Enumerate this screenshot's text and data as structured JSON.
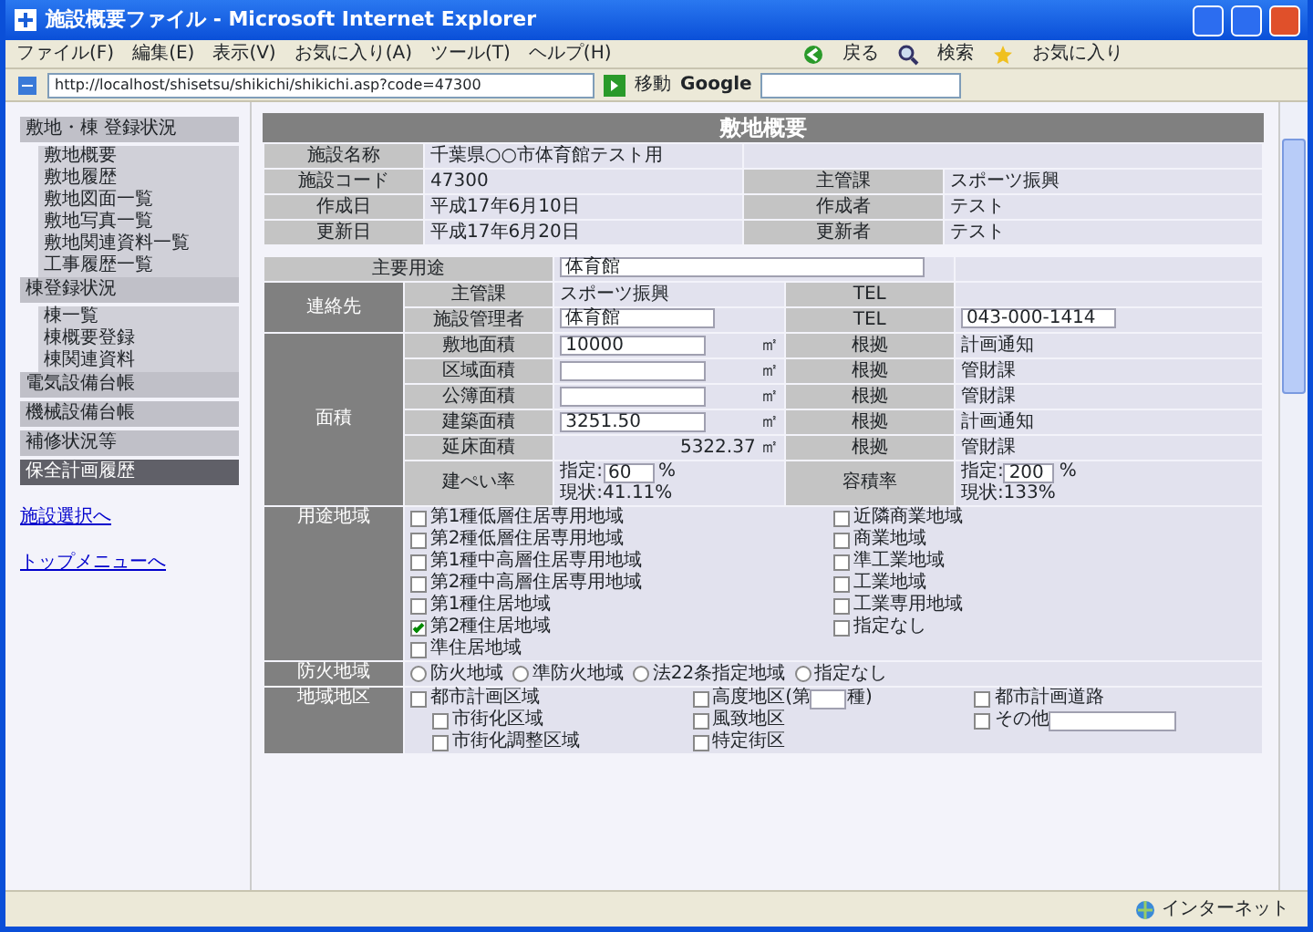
{
  "window": {
    "title": "施設概要ファイル - Microsoft Internet Explorer"
  },
  "menu": [
    "ファイル(F)",
    "編集(E)",
    "表示(V)",
    "お気に入り(A)",
    "ツール(T)",
    "ヘルプ(H)"
  ],
  "toolbar": {
    "back": "戻る",
    "search": "検索",
    "favorites": "お気に入り"
  },
  "address": {
    "url": "http://localhost/shisetsu/shikichi/shikichi.asp?code=47300"
  },
  "google": {
    "label": "Google",
    "go": "移動"
  },
  "sidebar": {
    "groups": [
      {
        "label": "敷地・棟 登録状況",
        "selected": false,
        "children": [
          {
            "label": "敷地概要",
            "selected": false
          },
          {
            "label": "敷地履歴",
            "selected": false
          },
          {
            "label": "敷地図面一覧",
            "selected": false
          },
          {
            "label": "敷地写真一覧",
            "selected": false
          },
          {
            "label": "敷地関連資料一覧",
            "selected": false
          },
          {
            "label": "工事履歴一覧",
            "selected": false
          }
        ]
      },
      {
        "label": "棟登録状況",
        "selected": false,
        "children": [
          {
            "label": "棟一覧",
            "selected": false
          },
          {
            "label": "棟概要登録",
            "selected": false
          },
          {
            "label": "棟関連資料",
            "selected": false
          }
        ]
      },
      {
        "label": "電気設備台帳",
        "selected": false
      },
      {
        "label": "機械設備台帳",
        "selected": false
      },
      {
        "label": "補修状況等",
        "selected": false
      },
      {
        "label": "保全計画履歴",
        "selected": true
      }
    ],
    "links": [
      "施設選択へ",
      "トップメニューへ"
    ]
  },
  "page": {
    "title": "敷地概要",
    "summary": [
      {
        "label": "施設名称",
        "value": "千葉県○○市体育館テスト用"
      },
      {
        "label": "施設コード",
        "value": "47300",
        "label2": "主管課",
        "value2": "スポーツ振興"
      },
      {
        "label": "作成日",
        "value": "平成17年6月10日",
        "label2": "作成者",
        "value2": "テスト"
      },
      {
        "label": "更新日",
        "value": "平成17年6月20日",
        "label2": "更新者",
        "value2": "テスト"
      }
    ],
    "main_use": {
      "label": "主要用途",
      "value": "体育館"
    },
    "sections": [
      {
        "heading": "連絡先",
        "rows": [
          [
            {
              "kind": "label",
              "text": "主管課"
            },
            {
              "kind": "value",
              "text": "スポーツ振興"
            },
            {
              "kind": "label",
              "text": "TEL"
            },
            {
              "kind": "value"
            }
          ],
          [
            {
              "kind": "label",
              "text": "施設管理者"
            },
            {
              "kind": "input",
              "value": "体育館"
            },
            {
              "kind": "label",
              "text": "TEL"
            },
            {
              "kind": "input",
              "value": "043-000-1414"
            }
          ]
        ]
      },
      {
        "heading": "面積",
        "rows": [
          [
            {
              "kind": "label",
              "text": "敷地面積"
            },
            {
              "kind": "area",
              "value": "10000",
              "unit": "㎡"
            },
            {
              "kind": "label",
              "text": "根拠"
            },
            {
              "kind": "value",
              "text": "計画通知"
            }
          ],
          [
            {
              "kind": "label",
              "text": "区域面積"
            },
            {
              "kind": "area",
              "unit": "㎡"
            },
            {
              "kind": "label",
              "text": "根拠"
            },
            {
              "kind": "value",
              "text": "管財課"
            }
          ],
          [
            {
              "kind": "label",
              "text": "公簿面積"
            },
            {
              "kind": "area",
              "unit": "㎡"
            },
            {
              "kind": "label",
              "text": "根拠"
            },
            {
              "kind": "value",
              "text": "管財課"
            }
          ],
          [
            {
              "kind": "label",
              "text": "建築面積"
            },
            {
              "kind": "area",
              "value": "3251.50",
              "unit": "㎡"
            },
            {
              "kind": "label",
              "text": "根拠"
            },
            {
              "kind": "value",
              "text": "計画通知"
            }
          ],
          [
            {
              "kind": "label",
              "text": "延床面積"
            },
            {
              "kind": "areatext",
              "value": "5322.37",
              "unit": "㎡"
            },
            {
              "kind": "label",
              "text": "根拠"
            },
            {
              "kind": "value",
              "text": "管財課"
            }
          ],
          [
            {
              "kind": "label",
              "text": "建ぺい率"
            },
            {
              "kind": "ratio",
              "prefix": "指定:",
              "value": "60",
              "suffix": "%",
              "current": "現状:41.11%"
            },
            {
              "kind": "label",
              "text": "容積率"
            },
            {
              "kind": "ratio",
              "prefix": "指定:",
              "value": "200",
              "suffix": "%",
              "current": "現状:133%"
            }
          ]
        ]
      }
    ],
    "zoning": {
      "heading": "用途地域",
      "columns": [
        [
          {
            "label": "第1種低層住居専用地域",
            "checked": false
          },
          {
            "label": "第2種低層住居専用地域",
            "checked": false
          },
          {
            "label": "第1種中高層住居専用地域",
            "checked": false
          },
          {
            "label": "第2種中高層住居専用地域",
            "checked": false
          },
          {
            "label": "第1種住居地域",
            "checked": false
          },
          {
            "label": "第2種住居地域",
            "checked": true
          },
          {
            "label": "準住居地域",
            "checked": false
          }
        ],
        [
          {
            "label": "近隣商業地域",
            "checked": false
          },
          {
            "label": "商業地域",
            "checked": false
          },
          {
            "label": "準工業地域",
            "checked": false
          },
          {
            "label": "工業地域",
            "checked": false
          },
          {
            "label": "工業専用地域",
            "checked": false
          },
          {
            "label": "指定なし",
            "checked": false
          }
        ]
      ]
    },
    "fire": {
      "heading": "防火地域",
      "options": [
        {
          "label": "防火地域",
          "selected": false
        },
        {
          "label": "準防火地域",
          "selected": false
        },
        {
          "label": "法22条指定地域",
          "selected": false
        },
        {
          "label": "指定なし",
          "selected": false
        }
      ]
    },
    "districts": {
      "heading": "地域地区",
      "columns": [
        [
          {
            "label": "都市計画区域",
            "checked": false,
            "children": [
              {
                "label": "市街化区域",
                "checked": false
              },
              {
                "label": "市街化調整区域",
                "checked": false
              }
            ]
          }
        ],
        [
          {
            "label": "高度地区(第",
            "checked": false,
            "kind": "input",
            "suffix": "種)"
          },
          {
            "label": "風致地区",
            "checked": false
          },
          {
            "label": "特定街区",
            "checked": false
          }
        ],
        [
          {
            "label": "都市計画道路",
            "checked": false
          },
          {
            "label": "その他",
            "checked": false,
            "kind": "input"
          }
        ]
      ]
    }
  },
  "status_bar": {
    "zone": "インターネット"
  }
}
